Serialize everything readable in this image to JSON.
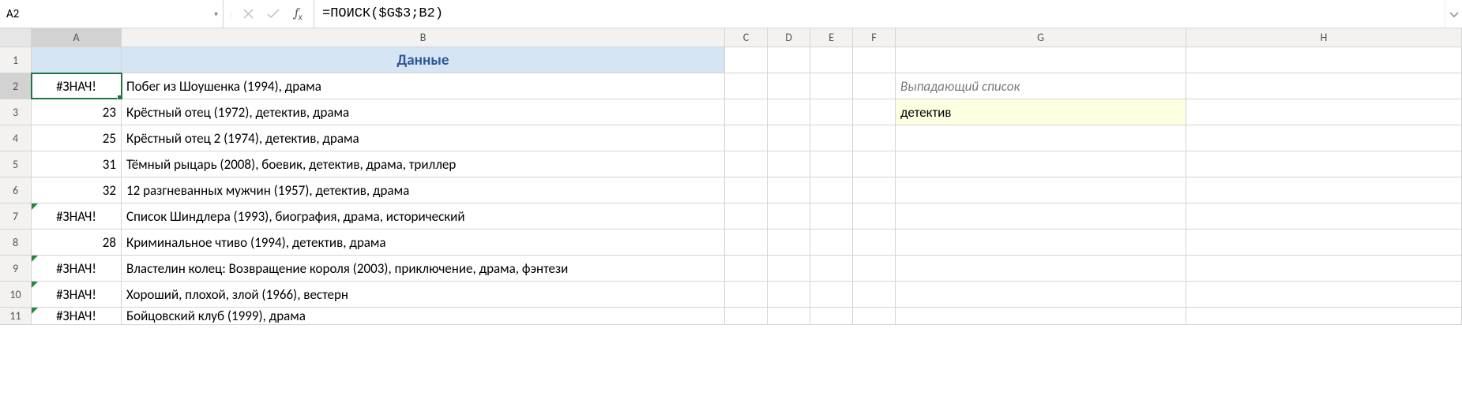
{
  "name_box": "A2",
  "formula": "=ПОИСК($G$3;B2)",
  "columns": [
    {
      "letter": "A",
      "cls": "c-A",
      "sel": true
    },
    {
      "letter": "B",
      "cls": "c-B"
    },
    {
      "letter": "C",
      "cls": "c-C"
    },
    {
      "letter": "D",
      "cls": "c-D"
    },
    {
      "letter": "E",
      "cls": "c-E"
    },
    {
      "letter": "F",
      "cls": "c-F"
    },
    {
      "letter": "G",
      "cls": "c-G"
    },
    {
      "letter": "H",
      "cls": "c-H"
    }
  ],
  "header_row": {
    "B": "Данные"
  },
  "g2_label": "Выпадающий список",
  "g3_value": "детектив",
  "rows": [
    {
      "n": 2,
      "A": "#ЗНАЧ!",
      "A_align": "center",
      "B": "Побег из Шоушенка (1994), драма",
      "err": false,
      "sel": true
    },
    {
      "n": 3,
      "A": "23",
      "A_align": "right",
      "B": "Крёстный отец (1972), детектив, драма"
    },
    {
      "n": 4,
      "A": "25",
      "A_align": "right",
      "B": "Крёстный отец 2 (1974), детектив, драма"
    },
    {
      "n": 5,
      "A": "31",
      "A_align": "right",
      "B": "Тёмный рыцарь (2008), боевик, детектив, драма, триллер"
    },
    {
      "n": 6,
      "A": "32",
      "A_align": "right",
      "B": "12 разгневанных мужчин (1957), детектив, драма"
    },
    {
      "n": 7,
      "A": "#ЗНАЧ!",
      "A_align": "center",
      "B": "Список Шиндлера (1993), биография, драма, исторический",
      "err": true
    },
    {
      "n": 8,
      "A": "28",
      "A_align": "right",
      "B": "Криминальное чтиво (1994), детектив, драма"
    },
    {
      "n": 9,
      "A": "#ЗНАЧ!",
      "A_align": "center",
      "B": "Властелин колец: Возвращение короля (2003), приключение, драма, фэнтези",
      "err": true
    },
    {
      "n": 10,
      "A": "#ЗНАЧ!",
      "A_align": "center",
      "B": "Хороший, плохой, злой (1966), вестерн",
      "err": true
    },
    {
      "n": 11,
      "A": "#ЗНАЧ!",
      "A_align": "center",
      "B": "Бойцовский клуб (1999), драма",
      "err": true,
      "last": true
    }
  ]
}
